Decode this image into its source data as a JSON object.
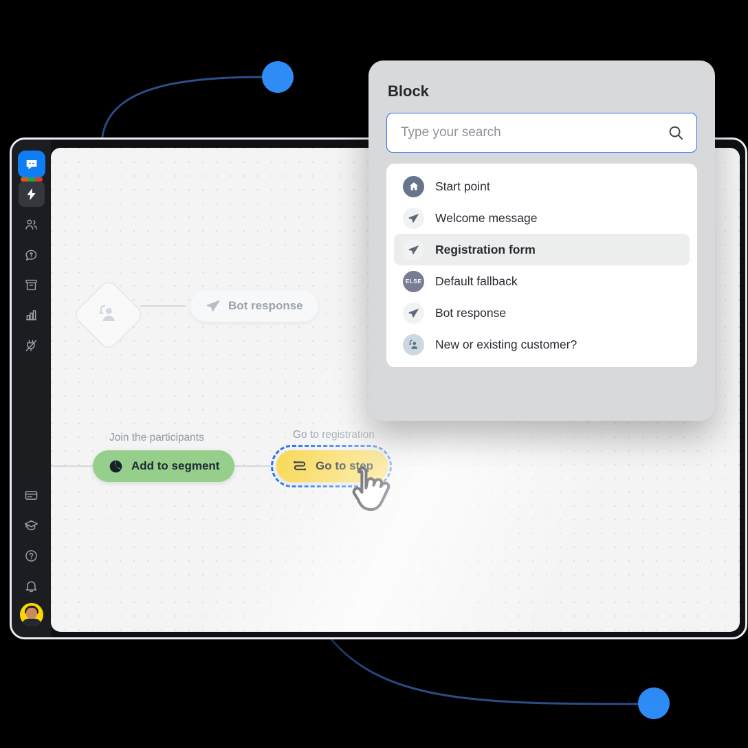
{
  "app": {
    "brand_icon": "livechat-logo-icon"
  },
  "sidebar": {
    "items": [
      {
        "name": "automation",
        "icon": "lightning-bolt-icon",
        "active": true
      },
      {
        "name": "team",
        "icon": "people-icon",
        "active": false
      },
      {
        "name": "chats",
        "icon": "chat-question-icon",
        "active": false
      },
      {
        "name": "archives",
        "icon": "archive-box-icon",
        "active": false
      },
      {
        "name": "reports",
        "icon": "bar-chart-icon",
        "active": false
      },
      {
        "name": "integrations",
        "icon": "plug-icon",
        "active": false
      }
    ],
    "bottom_items": [
      {
        "name": "billing",
        "icon": "credit-card-icon"
      },
      {
        "name": "learning",
        "icon": "graduation-cap-icon"
      },
      {
        "name": "help",
        "icon": "question-circle-icon"
      },
      {
        "name": "notifications",
        "icon": "bell-icon"
      }
    ],
    "avatar": {
      "name": "user-avatar",
      "background": "#ffd500"
    }
  },
  "canvas": {
    "nodes": [
      {
        "id": "bot-response",
        "label": "Bot response",
        "icon": "send-paper-plane-icon",
        "color": "#f7f8f9",
        "text_color": "#9aa3ad"
      },
      {
        "id": "add-to-segment",
        "label": "Add to segment",
        "caption": "Join the participants",
        "icon": "segment-pie-icon",
        "color": "#96ce8c",
        "text_color": "#1d2a33"
      },
      {
        "id": "go-to-step",
        "label": "Go to step",
        "caption": "Go to registration",
        "icon": "go-to-step-route-icon",
        "color": "#f8d854",
        "text_color": "#1d2a33",
        "selected": true,
        "selection_color": "#1e6ff0"
      }
    ],
    "decision_node": {
      "id": "new-or-existing-customer",
      "icon": "customer-question-icon"
    },
    "cursor": "hand-pointer-cursor",
    "grid": "dotted"
  },
  "panel": {
    "title": "Block",
    "search": {
      "placeholder": "Type your search",
      "value": "",
      "icon": "search-icon",
      "focus_color": "#2f6ff0"
    },
    "items": [
      {
        "label": "Start point",
        "icon": "home-icon",
        "icon_style": "ico-start",
        "selected": false
      },
      {
        "label": "Welcome message",
        "icon": "send-paper-plane-icon",
        "icon_style": "ico-send",
        "selected": false
      },
      {
        "label": "Registration form",
        "icon": "send-paper-plane-icon",
        "icon_style": "ico-send",
        "selected": true
      },
      {
        "label": "Default fallback",
        "icon": "else-badge-icon",
        "icon_style": "ico-else",
        "selected": false,
        "badge_text": "ELSE"
      },
      {
        "label": "Bot response",
        "icon": "send-paper-plane-icon",
        "icon_style": "ico-send",
        "selected": false
      },
      {
        "label": "New or existing customer?",
        "icon": "customer-question-icon",
        "icon_style": "ico-cust",
        "selected": false
      }
    ]
  },
  "decorations": {
    "node_color": "#2f8cf7",
    "wire_color": "#2c4f8a"
  }
}
